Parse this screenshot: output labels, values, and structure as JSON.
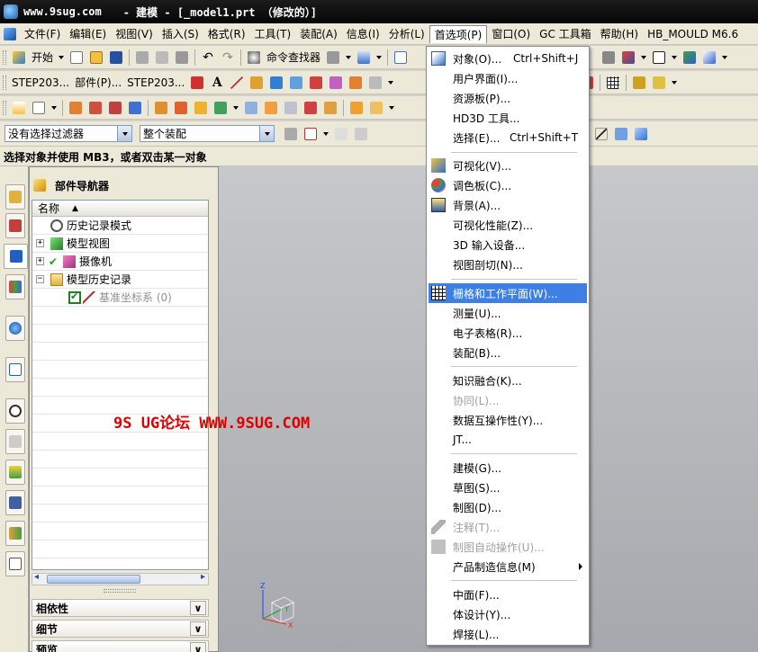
{
  "window": {
    "site": "www.9sug.com",
    "title": "- 建模 - [_model1.prt （修改的）]"
  },
  "menubar": {
    "items": [
      "文件(F)",
      "编辑(E)",
      "视图(V)",
      "插入(S)",
      "格式(R)",
      "工具(T)",
      "装配(A)",
      "信息(I)",
      "分析(L)",
      "首选项(P)",
      "窗口(O)",
      "GC 工具箱",
      "帮助(H)",
      "HB_MOULD M6.6"
    ],
    "active_index": 9
  },
  "toolbar1": {
    "start_label": "开始",
    "command_finder": "命令查找器"
  },
  "toolbar2": {
    "items": [
      "STEP203...",
      "部件(P)...",
      "STEP203..."
    ]
  },
  "selection": {
    "filter_value": "没有选择过滤器",
    "scope_value": "整个装配"
  },
  "status": {
    "prompt": "选择对象并使用 MB3，或者双击某一对象"
  },
  "navigator": {
    "title": "部件导航器",
    "column": "名称",
    "nodes": [
      {
        "label": "历史记录模式",
        "icon": "history-clock-icon"
      },
      {
        "label": "模型视图",
        "icon": "model-views-icon"
      },
      {
        "label": "摄像机",
        "icon": "camera-icon"
      },
      {
        "label": "模型历史记录",
        "icon": "folder-open-icon"
      },
      {
        "label": "基准坐标系 (0)",
        "icon": "datum-csys-icon"
      }
    ],
    "panels": [
      "相依性",
      "细节",
      "预览"
    ]
  },
  "watermark": {
    "text": "9S UG论坛 WWW.9SUG.COM",
    "color": "#e00000"
  },
  "dropdown": {
    "items": [
      {
        "label": "对象(O)...",
        "shortcut": "Ctrl+Shift+J",
        "icon": "object-icon"
      },
      {
        "label": "用户界面(I)...",
        "icon": ""
      },
      {
        "label": "资源板(P)...",
        "icon": ""
      },
      {
        "label": "HD3D 工具...",
        "icon": ""
      },
      {
        "label": "选择(E)...",
        "shortcut": "Ctrl+Shift+T",
        "icon": ""
      },
      {
        "label": "可视化(V)...",
        "icon": "visualization-icon"
      },
      {
        "label": "调色板(C)...",
        "icon": "palette-icon"
      },
      {
        "label": "背景(A)...",
        "icon": "background-icon"
      },
      {
        "label": "可视化性能(Z)...",
        "icon": ""
      },
      {
        "label": "3D 输入设备...",
        "icon": ""
      },
      {
        "label": "视图剖切(N)...",
        "icon": ""
      },
      {
        "label": "栅格和工作平面(W)...",
        "icon": "grid-icon"
      },
      {
        "label": "测量(U)...",
        "icon": ""
      },
      {
        "label": "电子表格(R)...",
        "icon": ""
      },
      {
        "label": "装配(B)...",
        "icon": ""
      },
      {
        "label": "知识融合(K)...",
        "icon": ""
      },
      {
        "label": "协同(L)...",
        "icon": ""
      },
      {
        "label": "数据互操作性(Y)...",
        "icon": ""
      },
      {
        "label": "JT...",
        "icon": ""
      },
      {
        "label": "建模(G)...",
        "icon": ""
      },
      {
        "label": "草图(S)...",
        "icon": ""
      },
      {
        "label": "制图(D)...",
        "icon": ""
      },
      {
        "label": "注释(T)...",
        "icon": "annotation-icon"
      },
      {
        "label": "制图自动操作(U)...",
        "icon": "drafting-automation-icon"
      },
      {
        "label": "产品制造信息(M)",
        "icon": ""
      },
      {
        "label": "中面(F)...",
        "icon": ""
      },
      {
        "label": "体设计(Y)...",
        "icon": ""
      },
      {
        "label": "焊接(L)...",
        "icon": ""
      }
    ],
    "highlight_color": "#3d7fe5"
  }
}
